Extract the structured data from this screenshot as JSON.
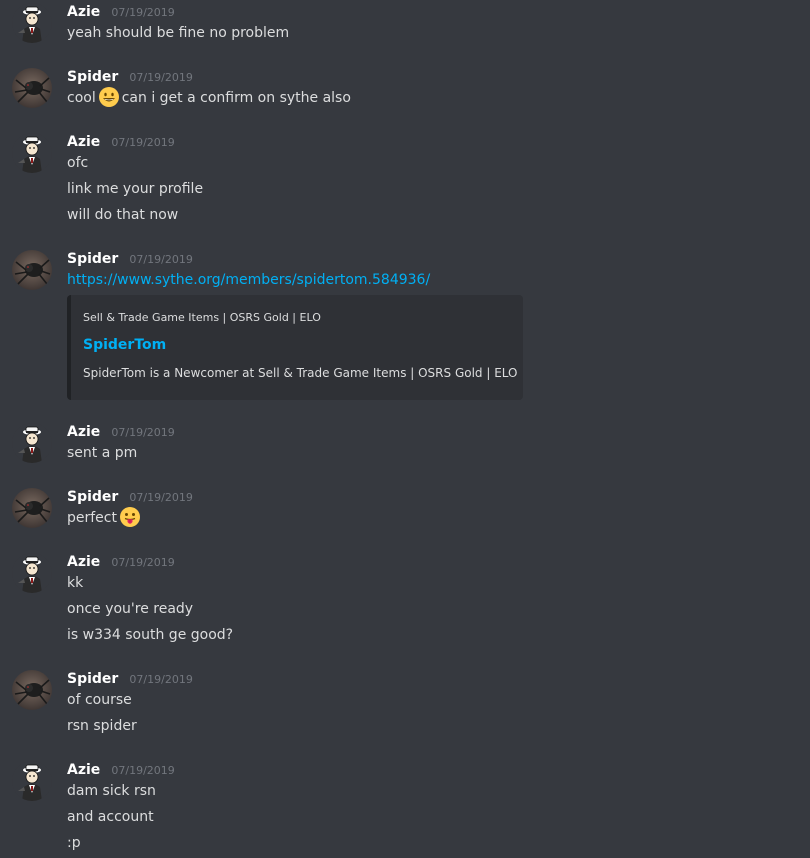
{
  "colors": {
    "background": "#36393f",
    "username": "#ffffff",
    "timestamp": "#72767d",
    "message_text": "#dcddde",
    "link": "#00b0f4",
    "embed_background": "#2f3136",
    "embed_border": "#202225"
  },
  "messages": [
    {
      "author": "Azie",
      "time": "07/19/2019",
      "avatar": "azie-avatar",
      "lines": [
        "yeah should be fine no problem"
      ]
    },
    {
      "author": "Spider",
      "time": "07/19/2019",
      "avatar": "spider-avatar",
      "lines": [
        {
          "before": "cool",
          "emoji": "smiley-emoji",
          "after": "can i get a confirm on sythe also"
        }
      ]
    },
    {
      "author": "Azie",
      "time": "07/19/2019",
      "avatar": "azie-avatar",
      "lines": [
        "ofc",
        "link me your profile",
        "will do that now"
      ]
    },
    {
      "author": "Spider",
      "time": "07/19/2019",
      "avatar": "spider-avatar",
      "link": "https://www.sythe.org/members/spidertom.584936/",
      "embed": {
        "provider": "Sell & Trade Game Items | OSRS Gold | ELO",
        "title": "SpiderTom",
        "description": "SpiderTom is a Newcomer at Sell & Trade Game Items | OSRS Gold | ELO"
      }
    },
    {
      "author": "Azie",
      "time": "07/19/2019",
      "avatar": "azie-avatar",
      "lines": [
        "sent a pm"
      ]
    },
    {
      "author": "Spider",
      "time": "07/19/2019",
      "avatar": "spider-avatar",
      "lines": [
        {
          "before": "perfect",
          "emoji": "tongue-emoji",
          "after": ""
        }
      ]
    },
    {
      "author": "Azie",
      "time": "07/19/2019",
      "avatar": "azie-avatar",
      "lines": [
        "kk",
        "once you're ready",
        "is w334 south ge good?"
      ]
    },
    {
      "author": "Spider",
      "time": "07/19/2019",
      "avatar": "spider-avatar",
      "lines": [
        "of course",
        "rsn spider"
      ]
    },
    {
      "author": "Azie",
      "time": "07/19/2019",
      "avatar": "azie-avatar",
      "lines": [
        "dam sick rsn",
        "and account",
        ":p"
      ]
    }
  ]
}
